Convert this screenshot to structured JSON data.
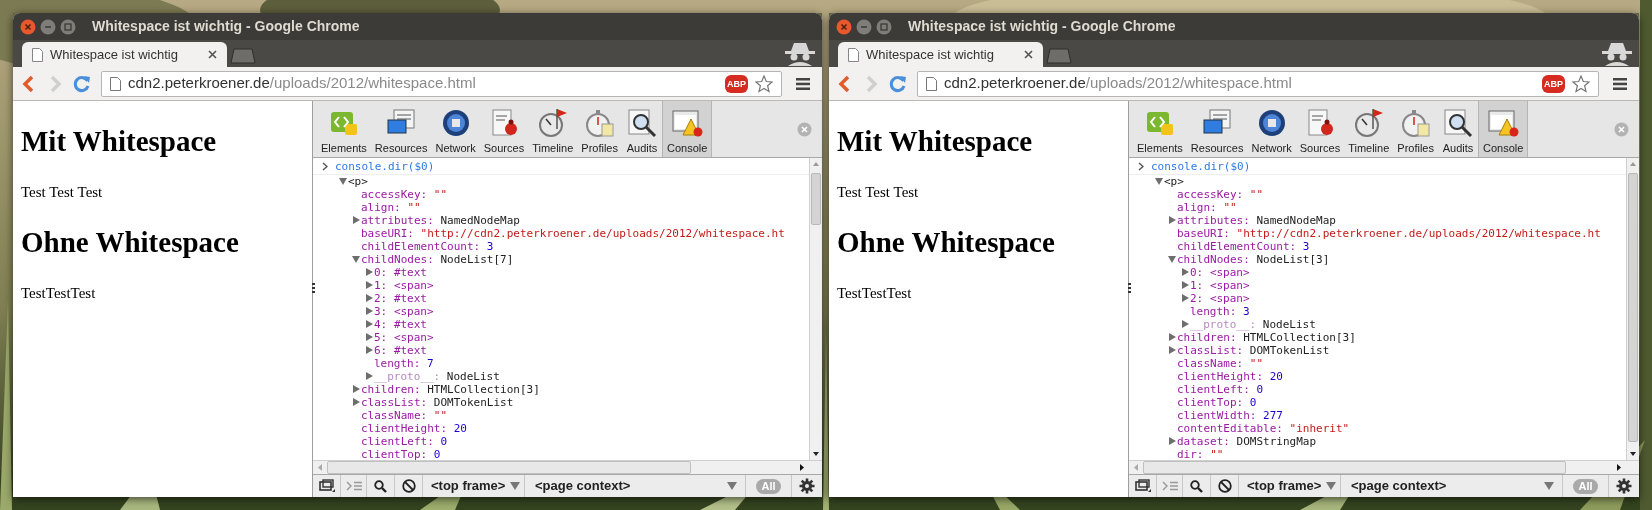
{
  "windows": [
    {
      "title": "Whitespace ist wichtig - Google Chrome",
      "tabs": [
        {
          "label": "Whitespace ist wichtig",
          "selected": true
        }
      ],
      "address": {
        "host": "cdn2.peterkroener.de",
        "path": "/uploads/2012/whitespace.html"
      },
      "extension_badge": "ABP",
      "page": [
        {
          "kind": "heading",
          "text": "Mit Whitespace"
        },
        {
          "kind": "paragraph",
          "text": "Test Test Test"
        },
        {
          "kind": "heading",
          "text": "Ohne Whitespace"
        },
        {
          "kind": "paragraph",
          "text": "TestTestTest"
        }
      ],
      "devtools": {
        "panels": [
          {
            "label": "Elements",
            "selected": false
          },
          {
            "label": "Resources",
            "selected": false
          },
          {
            "label": "Network",
            "selected": false
          },
          {
            "label": "Sources",
            "selected": false
          },
          {
            "label": "Timeline",
            "selected": false
          },
          {
            "label": "Profiles",
            "selected": false
          },
          {
            "label": "Audits",
            "selected": false
          },
          {
            "label": "Console",
            "selected": true
          }
        ],
        "console": {
          "command": "console.dir($0)",
          "tree": [
            {
              "kind": "tag",
              "key": "<p>",
              "expanded": true,
              "children": [
                {
                  "kind": "string",
                  "key": "accessKey:",
                  "value": "\"\""
                },
                {
                  "kind": "string",
                  "key": "align:",
                  "value": "\"\""
                },
                {
                  "kind": "object",
                  "key": "attributes:",
                  "value": "NamedNodeMap",
                  "expanded": false
                },
                {
                  "kind": "string",
                  "key": "baseURI:",
                  "value": "\"http://cdn2.peterkroener.de/uploads/2012/whitespace.ht"
                },
                {
                  "kind": "number",
                  "key": "childElementCount:",
                  "value": "3"
                },
                {
                  "kind": "object",
                  "key": "childNodes:",
                  "value": "NodeList[7]",
                  "expanded": true,
                  "children": [
                    {
                      "kind": "node",
                      "key": "0:",
                      "value": "#text",
                      "expanded": false
                    },
                    {
                      "kind": "node",
                      "key": "1:",
                      "value": "<span>",
                      "expanded": false
                    },
                    {
                      "kind": "node",
                      "key": "2:",
                      "value": "#text",
                      "expanded": false
                    },
                    {
                      "kind": "node",
                      "key": "3:",
                      "value": "<span>",
                      "expanded": false
                    },
                    {
                      "kind": "node",
                      "key": "4:",
                      "value": "#text",
                      "expanded": false
                    },
                    {
                      "kind": "node",
                      "key": "5:",
                      "value": "<span>",
                      "expanded": false
                    },
                    {
                      "kind": "node",
                      "key": "6:",
                      "value": "#text",
                      "expanded": false
                    },
                    {
                      "kind": "number",
                      "key": "length:",
                      "value": "7"
                    },
                    {
                      "kind": "internal",
                      "key": "__proto__:",
                      "value": "NodeList",
                      "expanded": false
                    }
                  ]
                },
                {
                  "kind": "object",
                  "key": "children:",
                  "value": "HTMLCollection[3]",
                  "expanded": false
                },
                {
                  "kind": "object",
                  "key": "classList:",
                  "value": "DOMTokenList",
                  "expanded": false
                },
                {
                  "kind": "string",
                  "key": "className:",
                  "value": "\"\""
                },
                {
                  "kind": "number",
                  "key": "clientHeight:",
                  "value": "20"
                },
                {
                  "kind": "number",
                  "key": "clientLeft:",
                  "value": "0"
                },
                {
                  "kind": "number",
                  "key": "clientTop:",
                  "value": "0"
                }
              ]
            }
          ]
        },
        "bottom_bar": {
          "frame_select": "<top frame>",
          "context_select": "<page context>",
          "filter_button": "All"
        }
      }
    },
    {
      "title": "Whitespace ist wichtig - Google Chrome",
      "tabs": [
        {
          "label": "Whitespace ist wichtig",
          "selected": true
        }
      ],
      "address": {
        "host": "cdn2.peterkroener.de",
        "path": "/uploads/2012/whitespace.html"
      },
      "extension_badge": "ABP",
      "page": [
        {
          "kind": "heading",
          "text": "Mit Whitespace"
        },
        {
          "kind": "paragraph",
          "text": "Test Test Test"
        },
        {
          "kind": "heading",
          "text": "Ohne Whitespace"
        },
        {
          "kind": "paragraph",
          "text": "TestTestTest"
        }
      ],
      "devtools": {
        "panels": [
          {
            "label": "Elements",
            "selected": false
          },
          {
            "label": "Resources",
            "selected": false
          },
          {
            "label": "Network",
            "selected": false
          },
          {
            "label": "Sources",
            "selected": false
          },
          {
            "label": "Timeline",
            "selected": false
          },
          {
            "label": "Profiles",
            "selected": false
          },
          {
            "label": "Audits",
            "selected": false
          },
          {
            "label": "Console",
            "selected": true
          }
        ],
        "console": {
          "command": "console.dir($0)",
          "tree": [
            {
              "kind": "tag",
              "key": "<p>",
              "expanded": true,
              "children": [
                {
                  "kind": "string",
                  "key": "accessKey:",
                  "value": "\"\""
                },
                {
                  "kind": "string",
                  "key": "align:",
                  "value": "\"\""
                },
                {
                  "kind": "object",
                  "key": "attributes:",
                  "value": "NamedNodeMap",
                  "expanded": false
                },
                {
                  "kind": "string",
                  "key": "baseURI:",
                  "value": "\"http://cdn2.peterkroener.de/uploads/2012/whitespace.ht"
                },
                {
                  "kind": "number",
                  "key": "childElementCount:",
                  "value": "3"
                },
                {
                  "kind": "object",
                  "key": "childNodes:",
                  "value": "NodeList[3]",
                  "expanded": true,
                  "children": [
                    {
                      "kind": "node",
                      "key": "0:",
                      "value": "<span>",
                      "expanded": false
                    },
                    {
                      "kind": "node",
                      "key": "1:",
                      "value": "<span>",
                      "expanded": false
                    },
                    {
                      "kind": "node",
                      "key": "2:",
                      "value": "<span>",
                      "expanded": false
                    },
                    {
                      "kind": "number",
                      "key": "length:",
                      "value": "3"
                    },
                    {
                      "kind": "internal",
                      "key": "__proto__:",
                      "value": "NodeList",
                      "expanded": false
                    }
                  ]
                },
                {
                  "kind": "object",
                  "key": "children:",
                  "value": "HTMLCollection[3]",
                  "expanded": false
                },
                {
                  "kind": "object",
                  "key": "classList:",
                  "value": "DOMTokenList",
                  "expanded": false
                },
                {
                  "kind": "string",
                  "key": "className:",
                  "value": "\"\""
                },
                {
                  "kind": "number",
                  "key": "clientHeight:",
                  "value": "20"
                },
                {
                  "kind": "number",
                  "key": "clientLeft:",
                  "value": "0"
                },
                {
                  "kind": "number",
                  "key": "clientTop:",
                  "value": "0"
                },
                {
                  "kind": "number",
                  "key": "clientWidth:",
                  "value": "277"
                },
                {
                  "kind": "string",
                  "key": "contentEditable:",
                  "value": "\"inherit\""
                },
                {
                  "kind": "object",
                  "key": "dataset:",
                  "value": "DOMStringMap",
                  "expanded": false
                },
                {
                  "kind": "string",
                  "key": "dir:",
                  "value": "\"\""
                }
              ]
            }
          ]
        },
        "bottom_bar": {
          "frame_select": "<top frame>",
          "context_select": "<page context>",
          "filter_button": "All"
        }
      }
    }
  ]
}
